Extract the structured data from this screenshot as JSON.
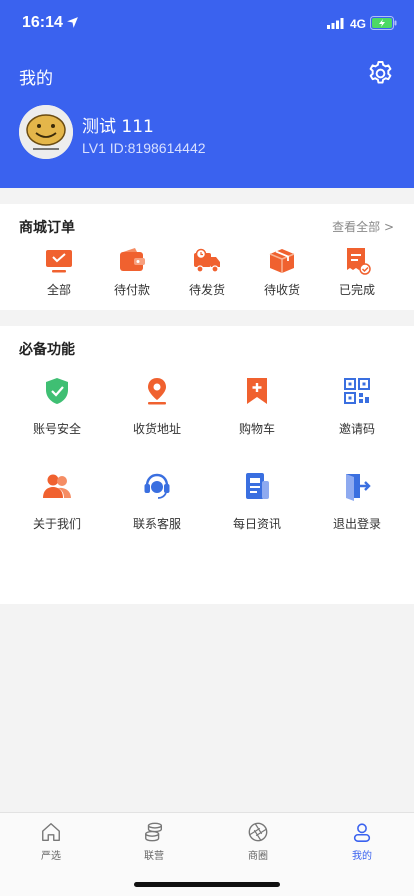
{
  "status": {
    "time": "16:14",
    "network": "4G",
    "icons": [
      "location-arrow-icon",
      "signal-icon",
      "battery-charging-icon"
    ]
  },
  "header": {
    "title": "我的",
    "settings_icon": "gear-icon",
    "username": "测试 111",
    "level": "LV1 ID:8198614442",
    "avatar_icon": "smiley-avatar"
  },
  "orders": {
    "title": "商城订单",
    "view_all": "查看全部 >",
    "items": [
      {
        "label": "全部",
        "icon": "monitor-icon"
      },
      {
        "label": "待付款",
        "icon": "wallet-icon"
      },
      {
        "label": "待发货",
        "icon": "delivery-truck-icon"
      },
      {
        "label": "待收货",
        "icon": "package-icon"
      },
      {
        "label": "已完成",
        "icon": "receipt-check-icon"
      }
    ]
  },
  "functions": {
    "title": "必备功能",
    "items": [
      {
        "label": "账号安全",
        "icon": "shield-check-icon"
      },
      {
        "label": "收货地址",
        "icon": "map-pin-icon"
      },
      {
        "label": "购物车",
        "icon": "bookmark-plus-icon"
      },
      {
        "label": "邀请码",
        "icon": "qr-code-icon"
      },
      {
        "label": "关于我们",
        "icon": "people-icon"
      },
      {
        "label": "联系客服",
        "icon": "headset-icon"
      },
      {
        "label": "每日资讯",
        "icon": "news-icon"
      },
      {
        "label": "退出登录",
        "icon": "logout-icon"
      }
    ]
  },
  "tabbar": {
    "tabs": [
      {
        "label": "严选",
        "icon": "home-icon"
      },
      {
        "label": "联营",
        "icon": "coins-icon"
      },
      {
        "label": "商圈",
        "icon": "aperture-icon"
      },
      {
        "label": "我的",
        "icon": "user-icon"
      }
    ],
    "active_index": 3
  },
  "colors": {
    "brand_blue": "#3a62ef",
    "accent_orange": "#f0612f",
    "func_green": "#3fbf73",
    "func_blue": "#3a6fe0"
  }
}
